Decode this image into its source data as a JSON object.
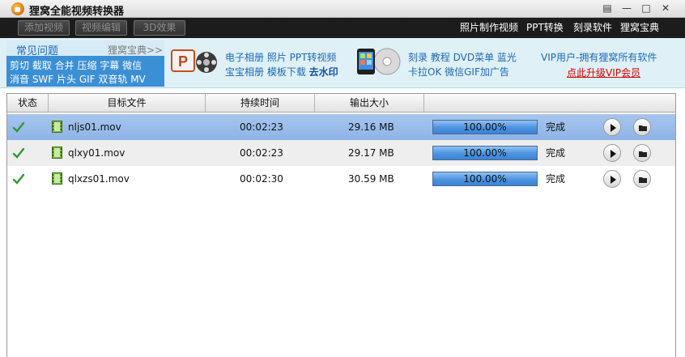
{
  "window": {
    "title": "狸窝全能视频转换器",
    "controls": {
      "restore": "▤",
      "minimize": "—",
      "maximize": "□",
      "close": "✕"
    }
  },
  "toolbar": {
    "add_video": "添加视频",
    "edit_video": "视频编辑",
    "effect_3d": "3D效果",
    "links": [
      "照片制作视频",
      "PPT转换",
      "刻录软件",
      "狸窝宝典"
    ]
  },
  "promo": {
    "faq_title": "常见问题",
    "faq_more": "狸窝宝典>>",
    "faq_line1": "剪切 截取 合并 压缩 字幕 微信",
    "faq_line2": "消音 SWF 片头 GIF 双音轨 MV",
    "ppt_line1": "电子相册 照片 PPT转视频",
    "ppt_line2_a": "宝宝相册 模板下载",
    "ppt_line2_b": "去水印",
    "burn_line1": "刻录 教程 DVD菜单 蓝光",
    "burn_line2": "卡拉OK 微信GIF加广告",
    "vip_text": "VIP用户-拥有狸窝所有软件",
    "vip_link": "点此升级VIP会员"
  },
  "table": {
    "headers": [
      "状态",
      "目标文件",
      "持续时间",
      "输出大小"
    ],
    "rows": [
      {
        "file": "nljs01.mov",
        "duration": "00:02:23",
        "size": "29.16 MB",
        "progress_label": "100.00%",
        "progress": 1.0,
        "status": "完成"
      },
      {
        "file": "qlxy01.mov",
        "duration": "00:02:23",
        "size": "29.17 MB",
        "progress_label": "100.00%",
        "progress": 1.0,
        "status": "完成"
      },
      {
        "file": "qlxzs01.mov",
        "duration": "00:02:30",
        "size": "30.59 MB",
        "progress_label": "100.00%",
        "progress": 1.0,
        "status": "完成"
      }
    ]
  },
  "colors": {
    "toolbar_bg": "#1c1c1c",
    "promo_bg": "#dff0f7",
    "faq_panel": "#3b8fd4",
    "selected_row": "#9bbdea",
    "vip_link": "#d30000"
  }
}
